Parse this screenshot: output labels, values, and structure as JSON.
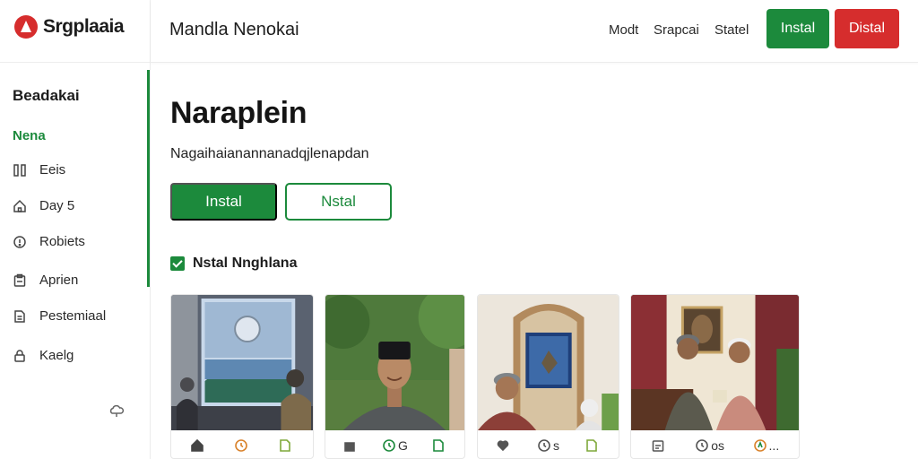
{
  "app": {
    "name": "Srgplaaia"
  },
  "header": {
    "title": "Mandla Nenokai",
    "links": [
      "Modt",
      "Srapcai",
      "Statel"
    ],
    "install_button": "Instal",
    "uninstall_button": "Distal"
  },
  "sidebar": {
    "heading": "Beadakai",
    "active_item": "Nena",
    "items": [
      {
        "label": "Eeis",
        "icon": "columns-icon"
      },
      {
        "label": "Day 5",
        "icon": "home-icon"
      },
      {
        "label": "Robiets",
        "icon": "info-icon"
      },
      {
        "label": "Aprien",
        "icon": "clipboard-icon"
      },
      {
        "label": "Pestemiaal",
        "icon": "document-icon"
      },
      {
        "label": "Kaelg",
        "icon": "lock-icon"
      }
    ],
    "bottom_icon": "cloud-icon"
  },
  "main": {
    "title": "Naraplein",
    "subtitle": "Nagaihaianannanadqjlenapdan",
    "primary_button": "Instal",
    "outline_button": "Nstal",
    "checkbox_label": "Nstal Nnghlana",
    "checkbox_checked": true
  },
  "cards": [
    {
      "scene": "presentation-screen",
      "footer": [
        {
          "icon": "home-icon",
          "text": ""
        },
        {
          "icon": "clock-icon",
          "text": ""
        },
        {
          "icon": "file-icon",
          "text": ""
        }
      ]
    },
    {
      "scene": "man-in-cap",
      "footer": [
        {
          "icon": "bag-icon",
          "text": ""
        },
        {
          "icon": "clock-icon",
          "text": "G"
        },
        {
          "icon": "file-icon",
          "text": ""
        }
      ]
    },
    {
      "scene": "framed-painting",
      "footer": [
        {
          "icon": "heart-icon",
          "text": ""
        },
        {
          "icon": "clock-icon",
          "text": "s"
        },
        {
          "icon": "file-icon",
          "text": ""
        }
      ]
    },
    {
      "scene": "two-men-interior",
      "footer": [
        {
          "icon": "calendar-icon",
          "text": ""
        },
        {
          "icon": "clock-icon",
          "text": "os"
        },
        {
          "icon": "badge-icon",
          "text": "..."
        }
      ]
    }
  ],
  "colors": {
    "accent": "#1c8a3c",
    "danger": "#d62d2d",
    "text": "#1a1a1a"
  }
}
